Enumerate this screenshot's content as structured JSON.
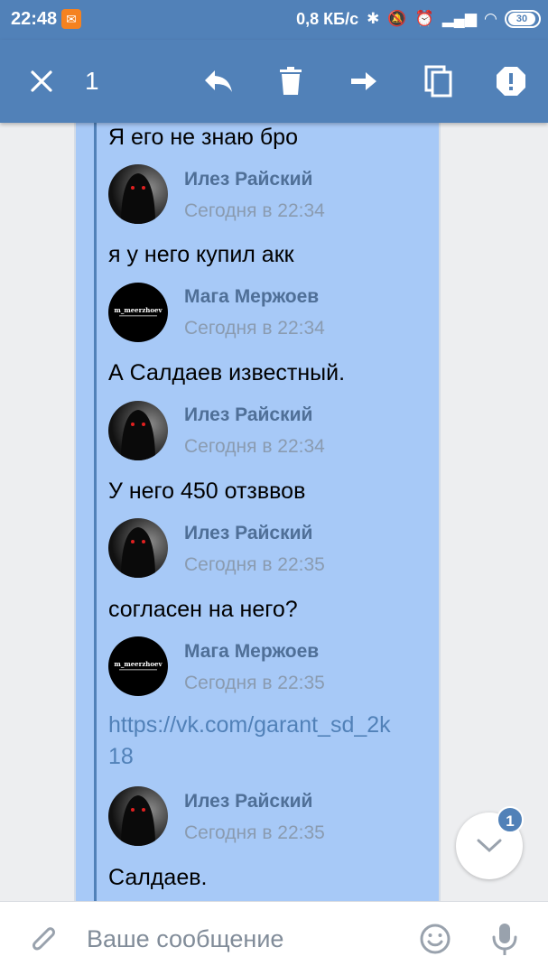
{
  "status_bar": {
    "time": "22:48",
    "network_speed": "0,8 КБ/с",
    "battery": "30",
    "icons": [
      "bluetooth-icon",
      "mute-icon",
      "alarm-icon",
      "signal-icon",
      "wifi-icon",
      "battery-icon"
    ]
  },
  "toolbar": {
    "selected_count": "1",
    "actions": [
      "close-icon",
      "reply-icon",
      "delete-icon",
      "forward-icon",
      "copy-icon",
      "report-icon"
    ]
  },
  "messages": [
    {
      "text": "Я его не знаю бро"
    },
    {
      "sender": "Илез Райский",
      "time": "Сегодня в 22:34",
      "text": "я у него купил акк",
      "avatar": "hooded-figure"
    },
    {
      "sender": "Мага Мержоев",
      "time": "Сегодня в 22:34",
      "text": "А Салдаев известный.",
      "avatar": "m_meerzhoev",
      "avatar_text": "m_meerzhoev"
    },
    {
      "sender": "Илез Райский",
      "time": "Сегодня в 22:34",
      "text": "У него 450 отзввов",
      "avatar": "hooded-figure"
    },
    {
      "sender": "Илез Райский",
      "time": "Сегодня в 22:35",
      "text": "согласен на него?",
      "avatar": "hooded-figure"
    },
    {
      "sender": "Мага Мержоев",
      "time": "Сегодня в 22:35",
      "link": "https://vk.com/garant_sd_2k18",
      "avatar": "m_meerzhoev",
      "avatar_text": "m_meerzhoev"
    },
    {
      "sender": "Илез Райский",
      "time": "Сегодня в 22:35",
      "text": "Салдаев.",
      "avatar": "hooded-figure"
    }
  ],
  "scroll_button": {
    "unread_badge": "1"
  },
  "composer": {
    "placeholder": "Ваше сообщение"
  },
  "colors": {
    "accent": "#5181b8",
    "selected_bg": "#a7c9f7",
    "link": "#5181b8"
  }
}
